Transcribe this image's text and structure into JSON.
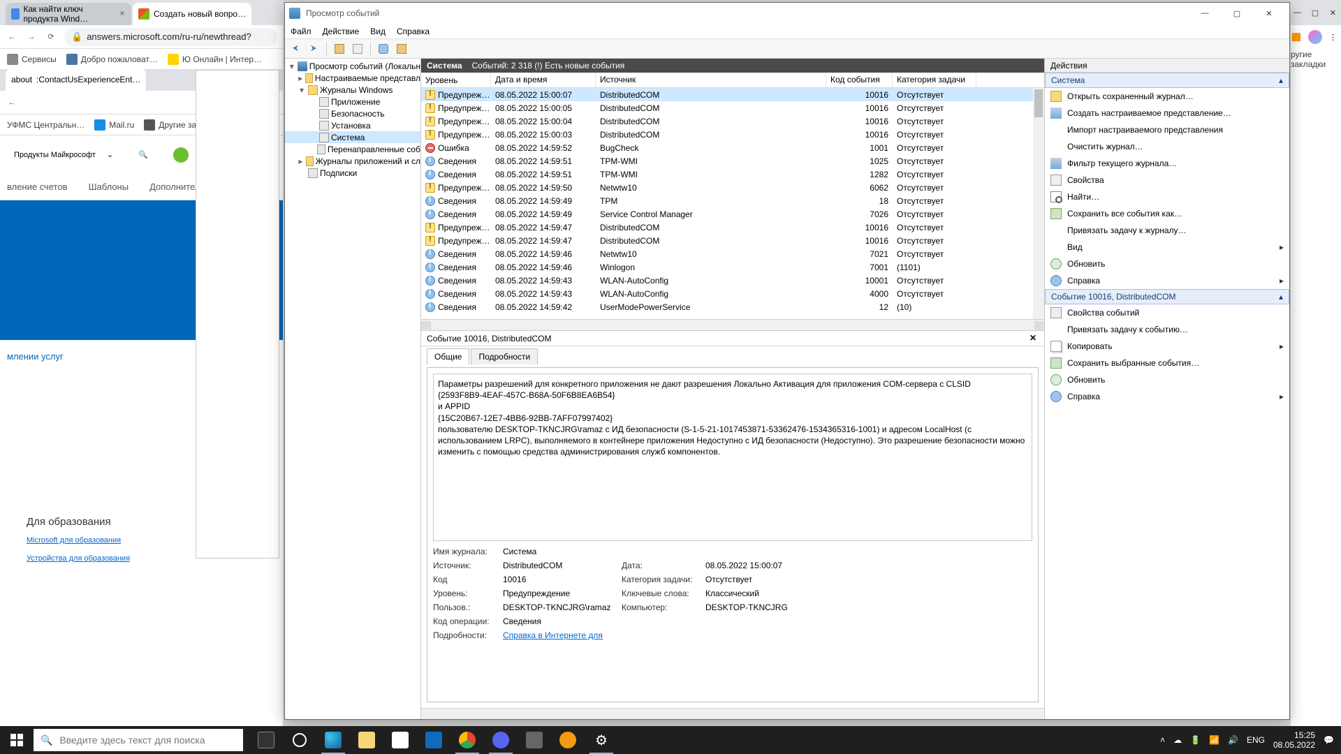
{
  "chrome": {
    "tabs": [
      {
        "title": "Как найти ключ продукта Wind…"
      },
      {
        "title": "Создать новый вопро…"
      }
    ],
    "url": "answers.microsoft.com/ru-ru/newthread?",
    "bookmarks": [
      "Сервисы",
      "Добро пожаловат…",
      "Ю Онлайн | Интер…"
    ],
    "bookmarks2": [
      "УФМС Центральн…",
      "Mail.ru",
      "Другие закладки"
    ],
    "page_tab": ":ContactUsExperienceEnt…",
    "ms_menu": "Продукты Майкрософт",
    "ms_nav": [
      "вление счетов",
      "Шаблоны",
      "Дополнительная по"
    ],
    "r_bookmarks": "ругие закладки",
    "edu": {
      "title": "Для образования",
      "l1": "Microsoft для образования",
      "l2": "Устройства для образования"
    },
    "svc": "млении услуг"
  },
  "evw": {
    "title": "Просмотр событий",
    "menu": [
      "Файл",
      "Действие",
      "Вид",
      "Справка"
    ],
    "tree": {
      "root": "Просмотр событий (Локальн",
      "custom": "Настраиваемые представл",
      "winlogs": "Журналы Windows",
      "logs": [
        "Приложение",
        "Безопасность",
        "Установка",
        "Система",
        "Перенаправленные соб"
      ],
      "applogs": "Журналы приложений и сл",
      "subs": "Подписки"
    },
    "header": {
      "name": "Система",
      "count": "Событий: 2 318 (!) Есть новые события"
    },
    "cols": {
      "level": "Уровень",
      "dt": "Дата и время",
      "src": "Источник",
      "id": "Код события",
      "cat": "Категория задачи"
    },
    "rows": [
      {
        "lvl": "warn",
        "lvl_t": "Предупреж…",
        "dt": "08.05.2022 15:00:07",
        "src": "DistributedCOM",
        "id": "10016",
        "cat": "Отсутствует",
        "sel": true
      },
      {
        "lvl": "warn",
        "lvl_t": "Предупреж…",
        "dt": "08.05.2022 15:00:05",
        "src": "DistributedCOM",
        "id": "10016",
        "cat": "Отсутствует"
      },
      {
        "lvl": "warn",
        "lvl_t": "Предупреж…",
        "dt": "08.05.2022 15:00:04",
        "src": "DistributedCOM",
        "id": "10016",
        "cat": "Отсутствует"
      },
      {
        "lvl": "warn",
        "lvl_t": "Предупреж…",
        "dt": "08.05.2022 15:00:03",
        "src": "DistributedCOM",
        "id": "10016",
        "cat": "Отсутствует"
      },
      {
        "lvl": "err",
        "lvl_t": "Ошибка",
        "dt": "08.05.2022 14:59:52",
        "src": "BugCheck",
        "id": "1001",
        "cat": "Отсутствует"
      },
      {
        "lvl": "info",
        "lvl_t": "Сведения",
        "dt": "08.05.2022 14:59:51",
        "src": "TPM-WMI",
        "id": "1025",
        "cat": "Отсутствует"
      },
      {
        "lvl": "info",
        "lvl_t": "Сведения",
        "dt": "08.05.2022 14:59:51",
        "src": "TPM-WMI",
        "id": "1282",
        "cat": "Отсутствует"
      },
      {
        "lvl": "warn",
        "lvl_t": "Предупреж…",
        "dt": "08.05.2022 14:59:50",
        "src": "Netwtw10",
        "id": "6062",
        "cat": "Отсутствует"
      },
      {
        "lvl": "info",
        "lvl_t": "Сведения",
        "dt": "08.05.2022 14:59:49",
        "src": "TPM",
        "id": "18",
        "cat": "Отсутствует"
      },
      {
        "lvl": "info",
        "lvl_t": "Сведения",
        "dt": "08.05.2022 14:59:49",
        "src": "Service Control Manager",
        "id": "7026",
        "cat": "Отсутствует"
      },
      {
        "lvl": "warn",
        "lvl_t": "Предупреж…",
        "dt": "08.05.2022 14:59:47",
        "src": "DistributedCOM",
        "id": "10016",
        "cat": "Отсутствует"
      },
      {
        "lvl": "warn",
        "lvl_t": "Предупреж…",
        "dt": "08.05.2022 14:59:47",
        "src": "DistributedCOM",
        "id": "10016",
        "cat": "Отсутствует"
      },
      {
        "lvl": "info",
        "lvl_t": "Сведения",
        "dt": "08.05.2022 14:59:46",
        "src": "Netwtw10",
        "id": "7021",
        "cat": "Отсутствует"
      },
      {
        "lvl": "info",
        "lvl_t": "Сведения",
        "dt": "08.05.2022 14:59:46",
        "src": "Winlogon",
        "id": "7001",
        "cat": "(1101)"
      },
      {
        "lvl": "info",
        "lvl_t": "Сведения",
        "dt": "08.05.2022 14:59:43",
        "src": "WLAN-AutoConfig",
        "id": "10001",
        "cat": "Отсутствует"
      },
      {
        "lvl": "info",
        "lvl_t": "Сведения",
        "dt": "08.05.2022 14:59:43",
        "src": "WLAN-AutoConfig",
        "id": "4000",
        "cat": "Отсутствует"
      },
      {
        "lvl": "info",
        "lvl_t": "Сведения",
        "dt": "08.05.2022 14:59:42",
        "src": "UserModePowerService",
        "id": "12",
        "cat": "(10)"
      }
    ],
    "detail": {
      "title": "Событие 10016, DistributedCOM",
      "tab1": "Общие",
      "tab2": "Подробности",
      "msg": "Параметры разрешений для конкретного приложения не дают разрешения Локально Активация для приложения COM-сервера с CLSID\n{2593F8B9-4EAF-457C-B68A-50F6B8EA6B54}\nи APPID\n{15C20B67-12E7-4BB6-92BB-7AFF07997402}\nпользователю DESKTOP-TKNCJRG\\ramaz с ИД безопасности (S-1-5-21-1017453871-53362476-1534365316-1001) и адресом LocalHost (с использованием LRPC), выполняемого в контейнере приложения Недоступно с ИД безопасности (Недоступно). Это разрешение безопасности можно изменить с помощью средства администрирования служб компонентов.",
      "f": {
        "log_l": "Имя журнала:",
        "log_v": "Система",
        "src_l": "Источник:",
        "src_v": "DistributedCOM",
        "date_l": "Дата:",
        "date_v": "08.05.2022 15:00:07",
        "id_l": "Код",
        "id_v": "10016",
        "cat_l": "Категория задачи:",
        "cat_v": "Отсутствует",
        "lvl_l": "Уровень:",
        "lvl_v": "Предупреждение",
        "kw_l": "Ключевые слова:",
        "kw_v": "Классический",
        "usr_l": "Пользов.:",
        "usr_v": "DESKTOP-TKNCJRG\\ramaz",
        "cmp_l": "Компьютер:",
        "cmp_v": "DESKTOP-TKNCJRG",
        "op_l": "Код операции:",
        "op_v": "Сведения",
        "det_l": "Подробности:",
        "det_v": "Справка в Интернете для "
      }
    },
    "actions": {
      "title": "Действия",
      "sec1": "Система",
      "items1": [
        {
          "t": "Открыть сохраненный журнал…",
          "i": "ico-open"
        },
        {
          "t": "Создать настраиваемое представление…",
          "i": "ico-filter"
        },
        {
          "t": "Импорт настраиваемого представления",
          "i": ""
        },
        {
          "t": "Очистить журнал…",
          "i": ""
        },
        {
          "t": "Фильтр текущего журнала…",
          "i": "ico-filter"
        },
        {
          "t": "Свойства",
          "i": "ico-prop"
        },
        {
          "t": "Найти…",
          "i": "ico-find"
        },
        {
          "t": "Сохранить все события как…",
          "i": "ico-save"
        },
        {
          "t": "Привязать задачу к журналу…",
          "i": ""
        },
        {
          "t": "Вид",
          "i": "",
          "arrow": true
        },
        {
          "t": "Обновить",
          "i": "ico-refresh"
        },
        {
          "t": "Справка",
          "i": "ico-help",
          "arrow": true
        }
      ],
      "sec2": "Событие 10016, DistributedCOM",
      "items2": [
        {
          "t": "Свойства событий",
          "i": "ico-prop"
        },
        {
          "t": "Привязать задачу к событию…",
          "i": ""
        },
        {
          "t": "Копировать",
          "i": "ico-copy",
          "arrow": true
        },
        {
          "t": "Сохранить выбранные события…",
          "i": "ico-save"
        },
        {
          "t": "Обновить",
          "i": "ico-refresh"
        },
        {
          "t": "Справка",
          "i": "ico-help",
          "arrow": true
        }
      ]
    }
  },
  "taskbar": {
    "search": "Введите здесь текст для поиска",
    "lang": "ENG",
    "time": "15:25",
    "date": "08.05.2022"
  }
}
